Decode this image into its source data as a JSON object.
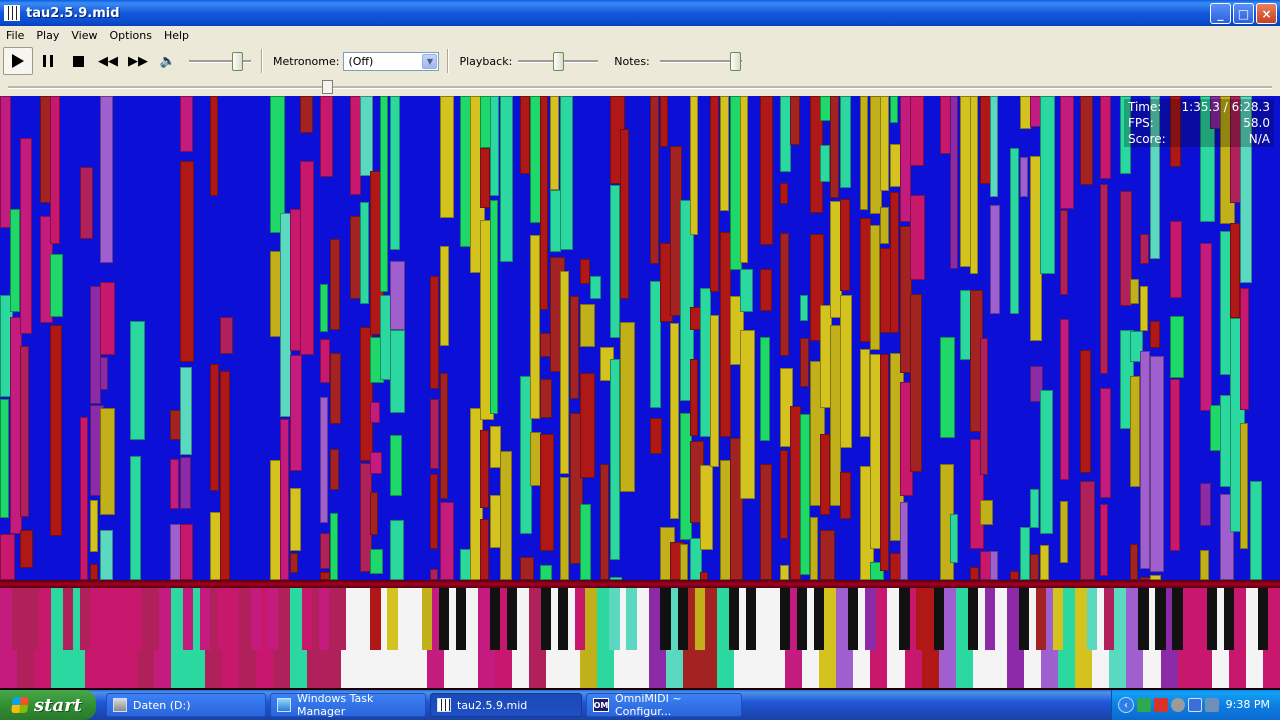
{
  "window": {
    "title": "tau2.5.9.mid"
  },
  "menu": [
    "File",
    "Play",
    "View",
    "Options",
    "Help"
  ],
  "toolbar": {
    "metronome_label": "Metronome:",
    "metronome_value": "(Off)",
    "playback_label": "Playback:",
    "notes_label": "Notes:",
    "volume_level": 0.85,
    "playback_level": 0.5,
    "notes_level": 0.98,
    "seek_position": 0.25
  },
  "info": {
    "time_label": "Time:",
    "time_value": "1:35.3 / 6:28.3",
    "fps_label": "FPS:",
    "fps_value": "58.0",
    "score_label": "Score:",
    "score_value": "N/A"
  },
  "colors": {
    "background": "#0c10d6",
    "note_colors": [
      "#c8186e",
      "#b0205a",
      "#c41b7e",
      "#8d2aa8",
      "#b01818",
      "#a32222",
      "#c2b01a",
      "#d4c21e",
      "#1ed86a",
      "#2ad8a0",
      "#5ad8c0",
      "#9f5fcf"
    ]
  },
  "taskbar": {
    "start_label": "start",
    "tasks": [
      {
        "label": "Daten (D:)",
        "icon": "drive-icon"
      },
      {
        "label": "Windows Task Manager",
        "icon": "task-manager-icon"
      },
      {
        "label": "tau2.5.9.mid",
        "icon": "piano-icon",
        "active": true
      },
      {
        "label": "OmniMIDI ~ Configur...",
        "icon": "omnimidi-icon"
      }
    ],
    "clock": "9:38 PM"
  }
}
